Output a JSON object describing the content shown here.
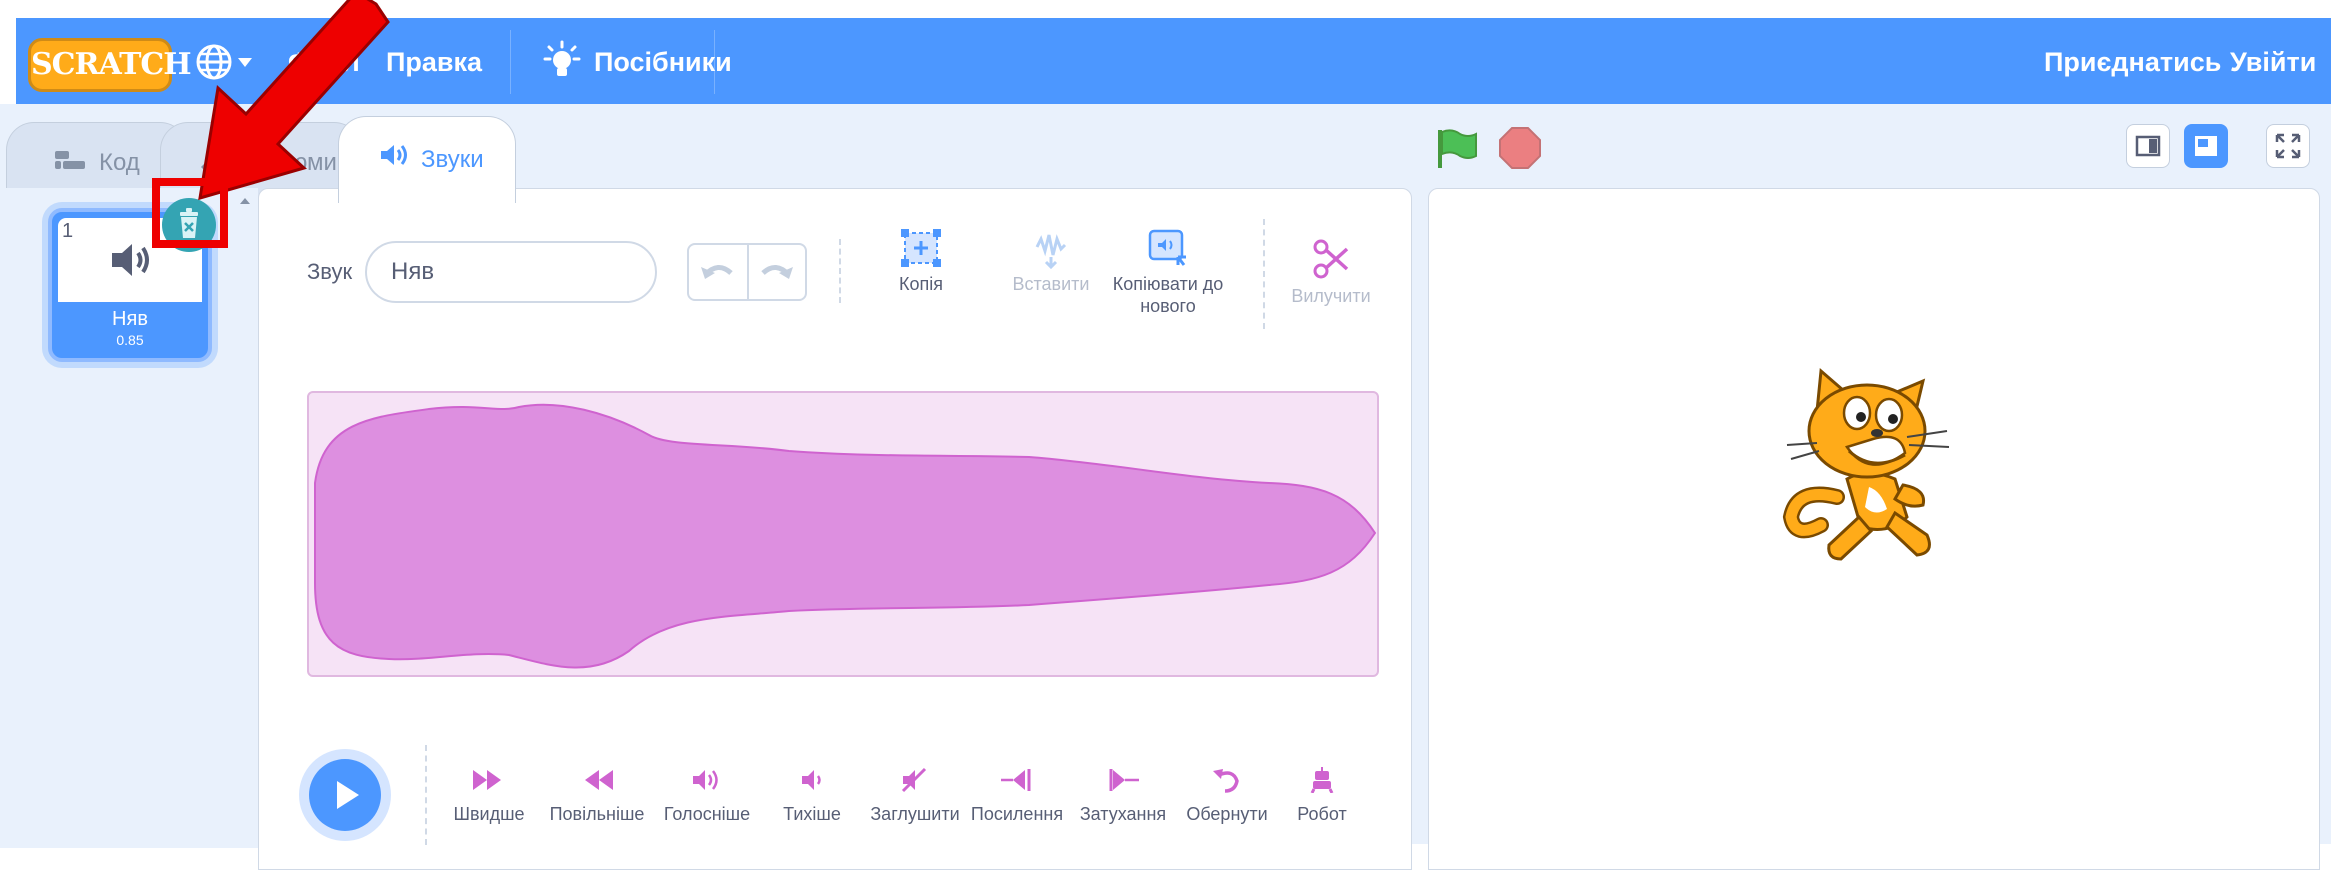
{
  "header": {
    "logo_text": "SCRATCH",
    "menu_file": "Файл",
    "menu_edit": "Правка",
    "tutorials": "Посібники",
    "join": "Приєднатись",
    "signin": "Увійти"
  },
  "tabs": [
    {
      "label": "Код"
    },
    {
      "label": "Костюми"
    },
    {
      "label": "Звуки"
    }
  ],
  "sound_list": [
    {
      "index": "1",
      "name": "Няв",
      "duration": "0.85"
    }
  ],
  "editor": {
    "sound_label": "Звук",
    "sound_name": "Няв",
    "copy": "Копія",
    "paste": "Вставити",
    "copy_to_new": "Копіювати до нового",
    "delete": "Вилучити"
  },
  "effects": [
    {
      "label": "Швидше",
      "icon": "faster-icon"
    },
    {
      "label": "Повільніше",
      "icon": "slower-icon"
    },
    {
      "label": "Голосніше",
      "icon": "louder-icon"
    },
    {
      "label": "Тихіше",
      "icon": "softer-icon"
    },
    {
      "label": "Заглушити",
      "icon": "mute-icon"
    },
    {
      "label": "Посилення",
      "icon": "fade-in-icon"
    },
    {
      "label": "Затухання",
      "icon": "fade-out-icon"
    },
    {
      "label": "Обернути",
      "icon": "reverse-icon"
    },
    {
      "label": "Робот",
      "icon": "robot-icon"
    }
  ],
  "colors": {
    "accent": "#4c97ff",
    "sound_purple": "#cf63cf",
    "waveform_fill": "#dd8fe0",
    "annotation_red": "#ee0000"
  }
}
